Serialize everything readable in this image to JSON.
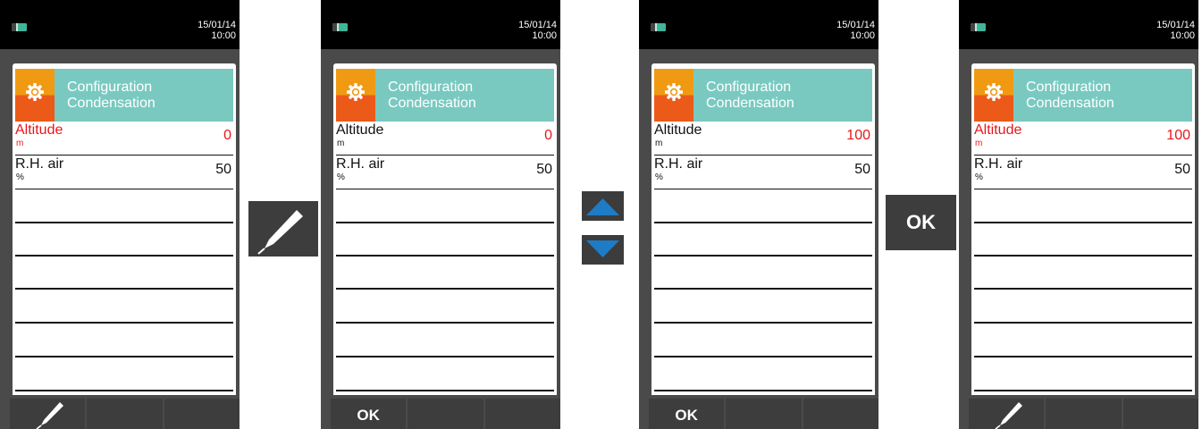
{
  "screens": [
    {
      "date": "15/01/14",
      "time": "10:00",
      "title": "Configuration",
      "subtitle": "Condensation",
      "altitude_label": "Altitude",
      "altitude_unit": "m",
      "altitude_value": "0",
      "rh_label": "R.H. air",
      "rh_unit": "%",
      "rh_value": "50",
      "softkeys": [
        "pen-icon",
        "",
        ""
      ]
    },
    {
      "date": "15/01/14",
      "time": "10:00",
      "title": "Configuration",
      "subtitle": "Condensation",
      "altitude_label": "Altitude",
      "altitude_unit": "m",
      "altitude_value": "0",
      "rh_label": "R.H. air",
      "rh_unit": "%",
      "rh_value": "50",
      "softkeys": [
        "OK",
        "",
        ""
      ]
    },
    {
      "date": "15/01/14",
      "time": "10:00",
      "title": "Configuration",
      "subtitle": "Condensation",
      "altitude_label": "Altitude",
      "altitude_unit": "m",
      "altitude_value": "100",
      "rh_label": "R.H. air",
      "rh_unit": "%",
      "rh_value": "50",
      "softkeys": [
        "OK",
        "",
        ""
      ]
    },
    {
      "date": "15/01/14",
      "time": "10:00",
      "title": "Configuration",
      "subtitle": "Condensation",
      "altitude_label": "Altitude",
      "altitude_unit": "m",
      "altitude_value": "100",
      "rh_label": "R.H. air",
      "rh_unit": "%",
      "rh_value": "50",
      "softkeys": [
        "pen-icon",
        "",
        ""
      ]
    }
  ],
  "steps": {
    "step1_icon": "pen-icon",
    "step2_icons": [
      "arrow-up-icon",
      "arrow-down-icon"
    ],
    "step3_label": "OK"
  },
  "colors": {
    "header_teal": "#79c9c0",
    "icon_orange": "#f09a14",
    "icon_red_orange": "#ec5a1a",
    "highlight_red": "#e8161b",
    "key_dark": "#3d3d3d",
    "arrow_blue": "#1e7bc6"
  }
}
